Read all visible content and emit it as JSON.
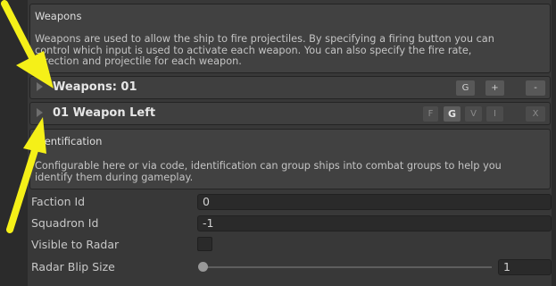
{
  "weapons_section": {
    "title": "Weapons",
    "description_lines": [
      "Weapons are used to allow the ship to fire projectiles. By specifying a firing button you can",
      "control which input is used to activate each weapon. You can also specify the fire rate,",
      "direction and projectile for each weapon."
    ]
  },
  "weapons_list": {
    "label": "Weapons: 01",
    "buttons": {
      "g": "G",
      "add": "+",
      "remove": "-"
    }
  },
  "weapon_item": {
    "label": "01 Weapon Left",
    "buttons": {
      "f": "F",
      "g": "G",
      "v": "V",
      "i": "I",
      "x": "X"
    }
  },
  "identification_section": {
    "title": "Identification",
    "description_lines": [
      "Configurable here or via code, identification can group ships into combat groups to help you",
      "identify them during gameplay."
    ]
  },
  "properties": {
    "faction_id": {
      "label": "Faction Id",
      "value": "0"
    },
    "squadron_id": {
      "label": "Squadron Id",
      "value": "-1"
    },
    "visible_to_radar": {
      "label": "Visible to Radar",
      "checked": false
    },
    "radar_blip_size": {
      "label": "Radar Blip Size",
      "value": "1",
      "slider_fraction": 0.0
    }
  },
  "annotation_color": "#f5f018"
}
